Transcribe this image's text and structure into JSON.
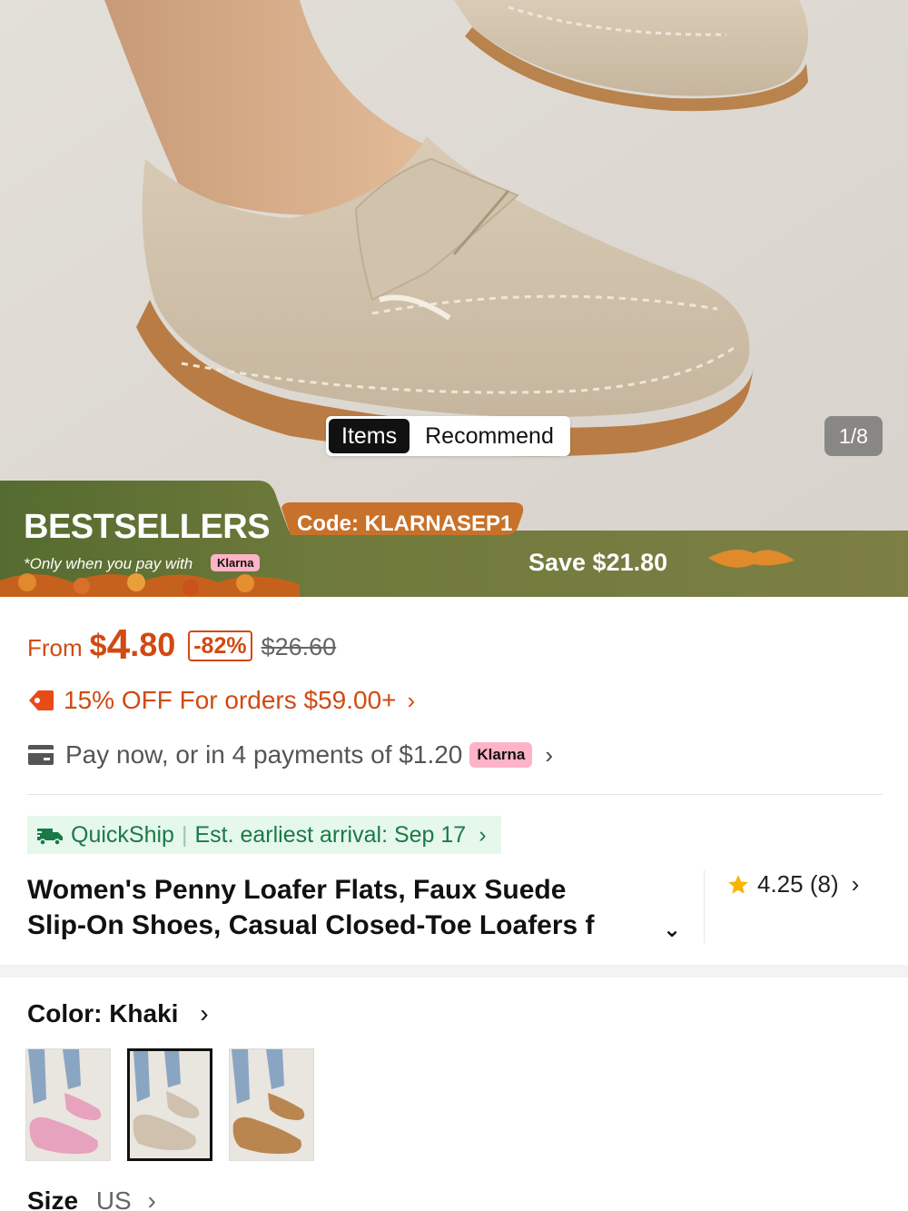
{
  "gallery": {
    "tabs": [
      {
        "label": "Items"
      },
      {
        "label": "Recommend"
      }
    ],
    "counter": "1/8"
  },
  "banner": {
    "title": "BESTSELLERS",
    "code": "Code: KLARNASEP1",
    "only_text": "*Only when you pay with",
    "klarna": "Klarna",
    "save": "Save $21.80"
  },
  "price": {
    "from": "From",
    "currency": "$",
    "whole": "4",
    "cents": ".80",
    "discount": "-82%",
    "original": "$26.60"
  },
  "coupon": {
    "text": "15% OFF For orders $59.00+",
    "chevron": "›"
  },
  "paynow": {
    "text": "Pay now, or in 4 payments of $1.20",
    "klarna": "Klarna",
    "chevron": "›"
  },
  "shipping": {
    "name": "QuickShip",
    "separator": "|",
    "arrival": "Est. earliest arrival: Sep 17",
    "chevron": "›"
  },
  "product": {
    "title_line1": "Women's Penny Loafer Flats, Faux Suede",
    "title_line2": "Slip-On Shoes, Casual Closed-Toe Loafers f",
    "expand": "⌄",
    "rating": "4.25 (8)",
    "rating_chevron": "›"
  },
  "color": {
    "label": "Color: Khaki",
    "chevron": "›",
    "options": [
      {
        "name": "pink",
        "hex": "#e7a2bd"
      },
      {
        "name": "khaki",
        "hex": "#cfc1ae",
        "selected": true
      },
      {
        "name": "brown",
        "hex": "#b98650"
      }
    ]
  },
  "size": {
    "label": "Size",
    "unit": "US",
    "chevron": "›"
  },
  "colors": {
    "accent": "#d14a12",
    "quickship_bg": "#e6f7ec",
    "quickship_text": "#1a7a47",
    "klarna_pink": "#ffb3c7",
    "banner_green": "#6e7a3b"
  }
}
